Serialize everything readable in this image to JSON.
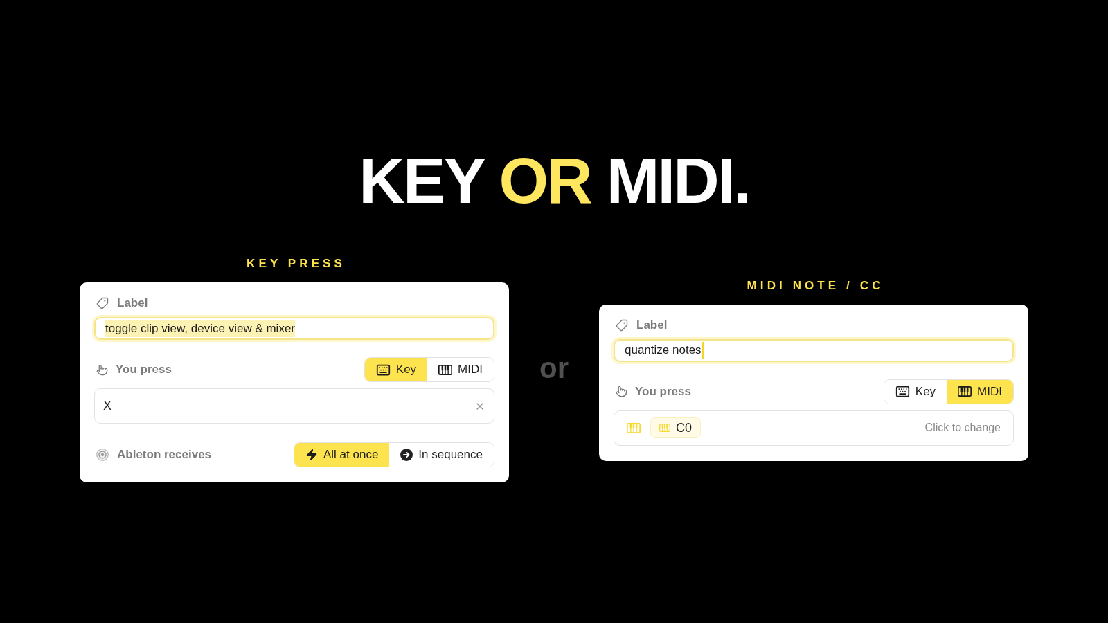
{
  "headline": {
    "parts": [
      {
        "text": "KEY",
        "accent": false
      },
      {
        "text": "OR",
        "accent": true
      },
      {
        "text": "MIDI.",
        "accent": false
      }
    ]
  },
  "divider_text": "or",
  "cards": [
    {
      "heading": "KEY PRESS",
      "label_field": {
        "title": "Label",
        "value": "toggle clip view, device view & mixer",
        "focused": true,
        "text_selected": true,
        "caret": false
      },
      "press": {
        "title": "You press",
        "modes": [
          {
            "label": "Key",
            "kind": "keyboard",
            "selected": true
          },
          {
            "label": "MIDI",
            "kind": "piano",
            "selected": false
          }
        ]
      },
      "trigger": {
        "kind": "key",
        "value": "X"
      },
      "receives": {
        "title": "Ableton receives",
        "options": [
          {
            "label": "All at once",
            "kind": "bolt",
            "selected": true
          },
          {
            "label": "In sequence",
            "kind": "arrow",
            "selected": false
          }
        ]
      }
    },
    {
      "heading": "MIDI NOTE / CC",
      "label_field": {
        "title": "Label",
        "value": "quantize notes",
        "focused": true,
        "text_selected": false,
        "caret": true
      },
      "press": {
        "title": "You press",
        "modes": [
          {
            "label": "Key",
            "kind": "keyboard",
            "selected": false
          },
          {
            "label": "MIDI",
            "kind": "piano",
            "selected": true
          }
        ]
      },
      "trigger": {
        "kind": "midi",
        "value": "C0",
        "hint": "Click to change"
      }
    }
  ]
}
